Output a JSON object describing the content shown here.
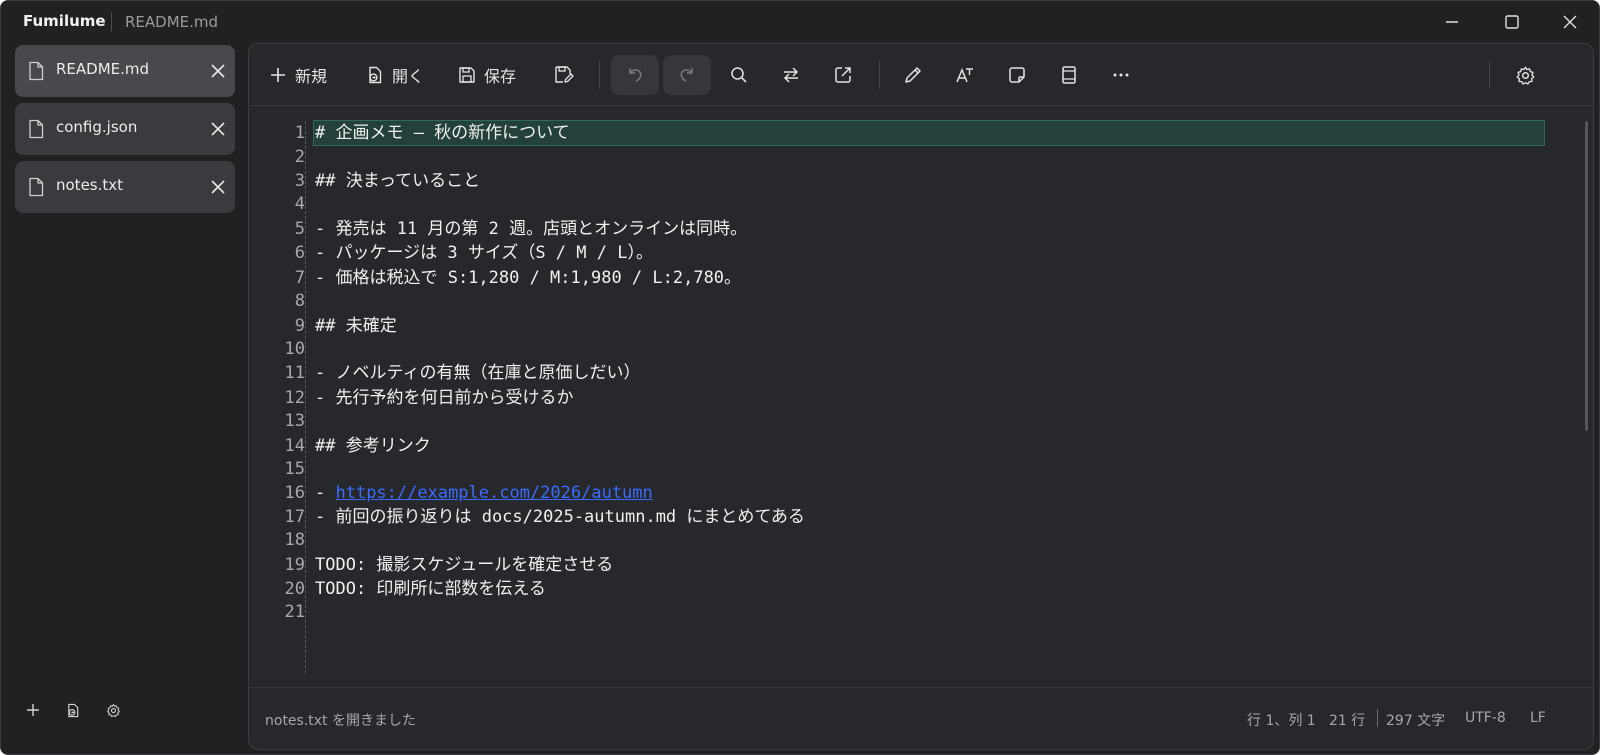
{
  "window": {
    "app_name": "Fumilume",
    "doc_title": "README.md"
  },
  "sidebar": {
    "tabs": [
      {
        "name": "README.md",
        "active": true
      },
      {
        "name": "config.json",
        "active": false
      },
      {
        "name": "notes.txt",
        "active": false
      }
    ],
    "bottom_icons": [
      "plus-icon",
      "open-file-icon",
      "gear-icon"
    ]
  },
  "toolbar": {
    "new_label": "新規",
    "open_label": "開く",
    "save_label": "保存",
    "icons": [
      "plus-icon",
      "open-file-icon",
      "save-icon",
      "save-as-icon",
      "undo-icon",
      "redo-icon",
      "search-icon",
      "replace-icon",
      "external-link-icon",
      "pencil-icon",
      "text-format-icon",
      "sticky-note-icon",
      "book-icon",
      "more-icon",
      "gear-icon"
    ]
  },
  "editor": {
    "line_numbers": [
      "1",
      "2",
      "3",
      "4",
      "5",
      "6",
      "7",
      "8",
      "9",
      "10",
      "11",
      "12",
      "13",
      "14",
      "15",
      "16",
      "17",
      "18",
      "19",
      "20",
      "21"
    ],
    "lines": {
      "l1": "# 企画メモ — 秋の新作について",
      "l3": "## 決まっていること",
      "l5": "- 発売は 11 月の第 2 週。店頭とオンラインは同時。",
      "l6": "- パッケージは 3 サイズ（S / M / L）。",
      "l7": "- 価格は税込で S:1,280 / M:1,980 / L:2,780。",
      "l9": "## 未確定",
      "l11": "- ノベルティの有無（在庫と原価しだい）",
      "l12": "- 先行予約を何日前から受けるか",
      "l14": "## 参考リンク",
      "l16_prefix": "- ",
      "l16_link": "https://example.com/2026/autumn",
      "l17": "- 前回の振り返りは docs/2025-autumn.md にまとめてある",
      "l19": "TODO: 撮影スケジュールを確定させる",
      "l20": "TODO: 印刷所に部数を伝える"
    }
  },
  "status": {
    "message": "notes.txt を開きました",
    "cursor": "行 1、列 1",
    "lines": "21 行",
    "chars": "297 文字",
    "encoding": "UTF-8",
    "eol": "LF"
  },
  "colors": {
    "background": "#202123",
    "panel": "#27282b",
    "current_line": "#23403a",
    "link": "#3a6cff"
  }
}
